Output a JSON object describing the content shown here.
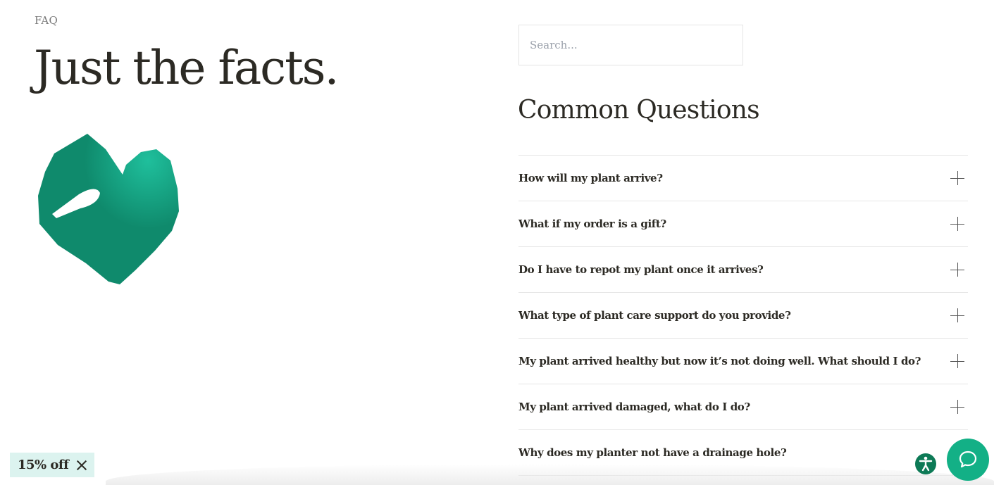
{
  "header": {
    "eyebrow": "FAQ",
    "title": "Just the facts."
  },
  "illustration": {
    "icon": "monstera-leaf-icon",
    "color": "#0f8a6c"
  },
  "search": {
    "placeholder": "Search...",
    "value": ""
  },
  "faq": {
    "title": "Common Questions",
    "questions": [
      {
        "q": "How will my plant arrive?"
      },
      {
        "q": "What if my order is a gift?"
      },
      {
        "q": "Do I have to repot my plant once it arrives?"
      },
      {
        "q": "What type of plant care support do you provide?"
      },
      {
        "q": "My plant arrived healthy but now it’s not doing well. What should I do?"
      },
      {
        "q": "My plant arrived damaged, what do I do?"
      },
      {
        "q": "Why does my planter not have a drainage hole?"
      }
    ],
    "expand_icon": "plus-icon"
  },
  "promo": {
    "label": "15% off",
    "close_icon": "close-icon",
    "background": "#dcf3ef"
  },
  "widgets": {
    "accessibility_icon": "accessibility-icon",
    "accessibility_color": "#0d7a56",
    "chat_icon": "chat-bubble-icon",
    "chat_color": "#13b086"
  }
}
